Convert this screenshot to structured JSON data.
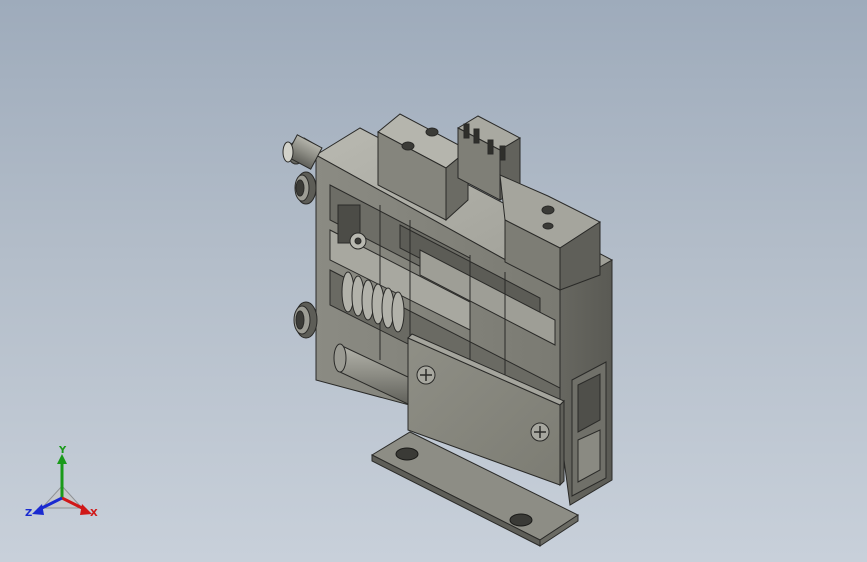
{
  "viewport": {
    "background_top": "#9eabbb",
    "background_bottom": "#c8d0da",
    "model_color": "#8a8a82"
  },
  "triad": {
    "x_label": "X",
    "y_label": "Y",
    "z_label": "Z",
    "x_color": "#d01818",
    "y_color": "#1a9a1a",
    "z_color": "#1a2ad0"
  }
}
